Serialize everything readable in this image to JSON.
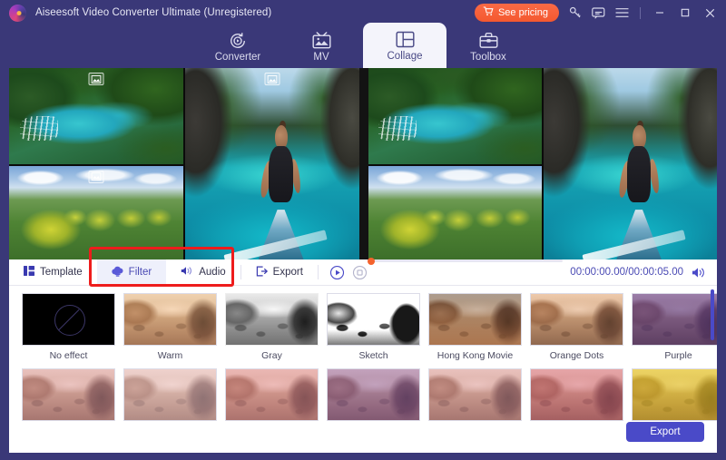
{
  "titlebar": {
    "app_title": "Aiseesoft Video Converter Ultimate (Unregistered)",
    "pricing_label": "See pricing",
    "icons": {
      "logo": "aiseesoft-logo",
      "cart": "cart-icon",
      "key": "key-icon",
      "feedback": "feedback-icon",
      "menu": "hamburger-menu-icon",
      "minimize": "minimize-icon",
      "maximize": "maximize-icon",
      "close": "close-icon"
    }
  },
  "tabs": [
    {
      "label": "Converter",
      "icon": "converter-icon",
      "active": false
    },
    {
      "label": "MV",
      "icon": "mv-icon",
      "active": false
    },
    {
      "label": "Collage",
      "icon": "collage-icon",
      "active": true
    },
    {
      "label": "Toolbox",
      "icon": "toolbox-icon",
      "active": false
    }
  ],
  "stage": {
    "cells": [
      {
        "name": "lagoon-cell",
        "badge": "image-placeholder-icon"
      },
      {
        "name": "hills-cell",
        "badge": "image-placeholder-icon"
      },
      {
        "name": "boat-cell",
        "badge": "image-placeholder-icon"
      }
    ]
  },
  "editbar": {
    "tools": [
      {
        "label": "Template",
        "icon": "template-icon",
        "active": false
      },
      {
        "label": "Filter",
        "icon": "filter-icon",
        "active": true
      },
      {
        "label": "Audio",
        "icon": "audio-icon",
        "active": false
      },
      {
        "label": "Export",
        "icon": "export-icon",
        "active": false
      }
    ],
    "transport": {
      "play": "play-icon",
      "stop": "stop-icon",
      "volume": "volume-icon"
    },
    "timecode": "00:00:00.00/00:00:05.00"
  },
  "annotation": {
    "color": "#ee1c1c",
    "target": "filter-audio-tabs"
  },
  "filters": {
    "row1": [
      {
        "label": "No effect",
        "style": "none"
      },
      {
        "label": "Warm",
        "style": "warm"
      },
      {
        "label": "Gray",
        "style": "gray"
      },
      {
        "label": "Sketch",
        "style": "sketch"
      },
      {
        "label": "Hong Kong Movie",
        "style": "hkm"
      },
      {
        "label": "Orange Dots",
        "style": "dots"
      },
      {
        "label": "Purple",
        "style": "purple"
      }
    ],
    "row2": [
      {
        "label": "",
        "style": "pinkA"
      },
      {
        "label": "",
        "style": "pinkB"
      },
      {
        "label": "",
        "style": "pinkC"
      },
      {
        "label": "",
        "style": "violet"
      },
      {
        "label": "",
        "style": "pinkA"
      },
      {
        "label": "",
        "style": "rose"
      },
      {
        "label": "",
        "style": "yellow"
      }
    ]
  },
  "panel": {
    "export_label": "Export"
  },
  "colors": {
    "window_bg": "#3a3878",
    "accent_blue": "#4a4ac8",
    "accent_orange": "#f4582f",
    "annotation_red": "#ee1c1c",
    "panel_bg": "#ffffff"
  }
}
